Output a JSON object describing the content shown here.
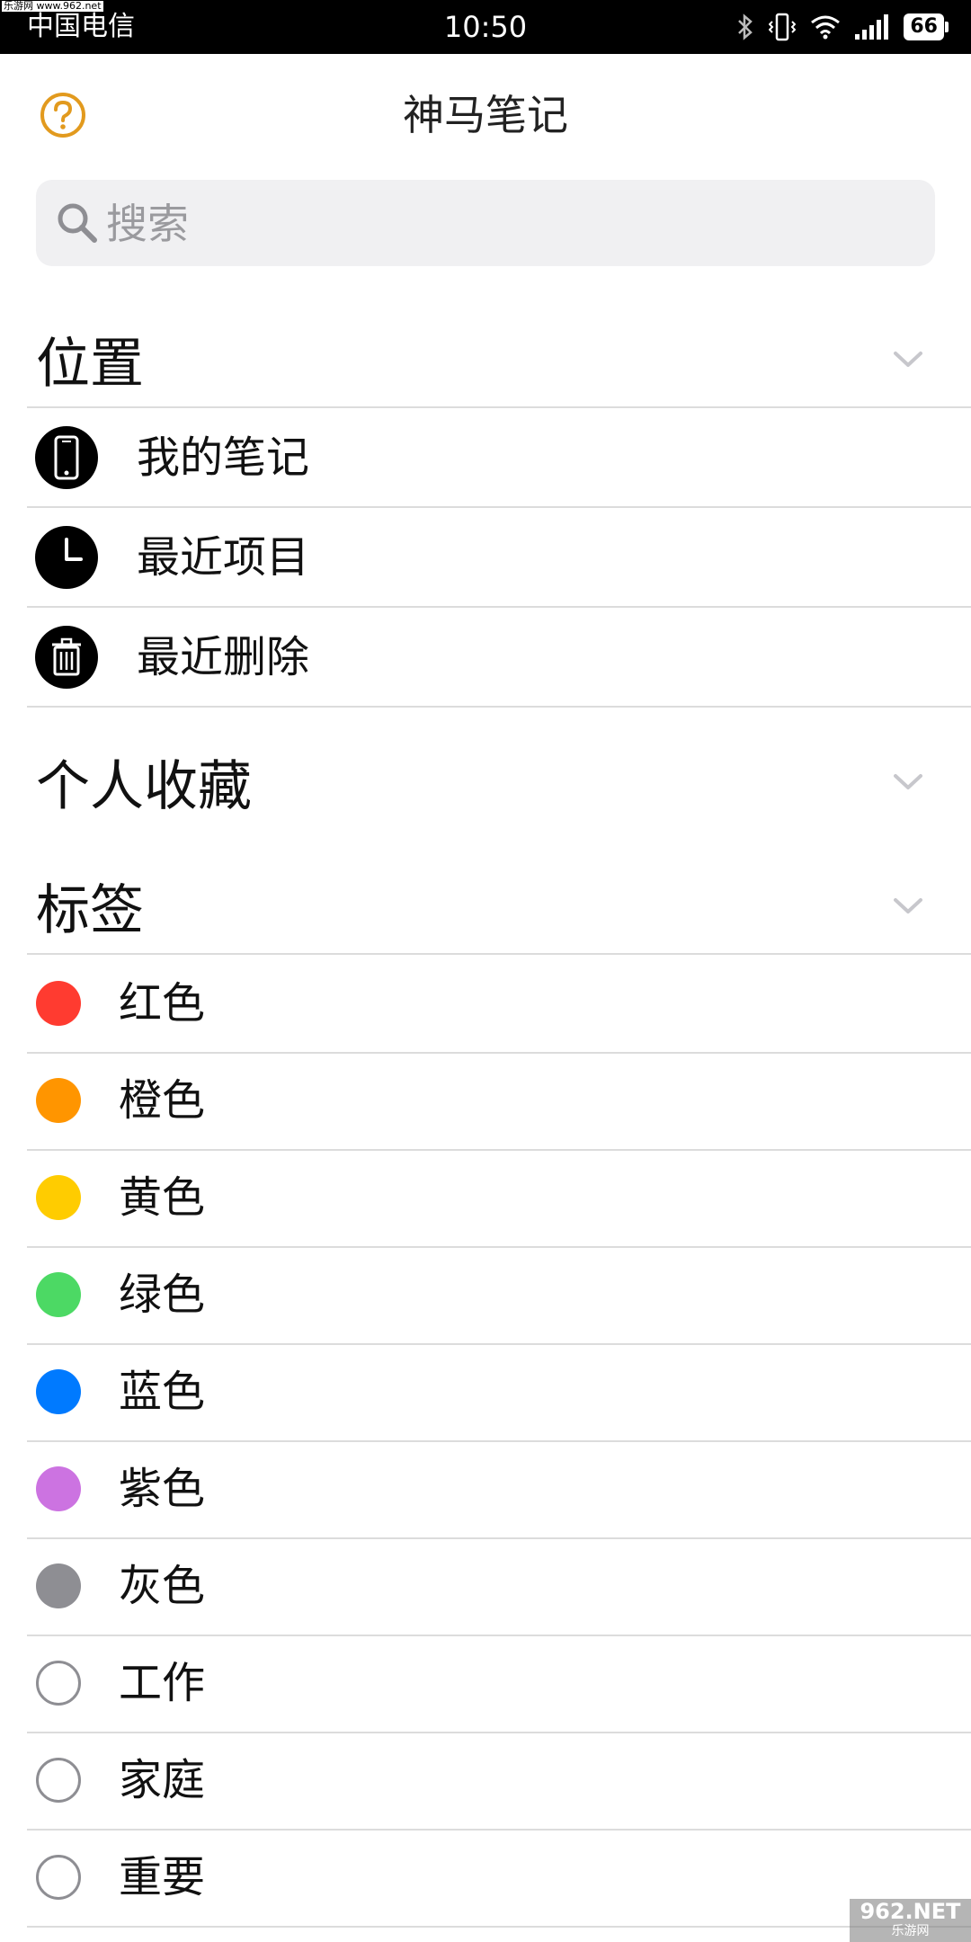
{
  "status_bar": {
    "watermark": "乐游网 www.962.net",
    "carrier": "中国电信",
    "time": "10:50",
    "battery": "66"
  },
  "header": {
    "title": "神马笔记",
    "help_icon": "question-circle-icon",
    "accent_color": "#e29a1e"
  },
  "search": {
    "placeholder": "搜索"
  },
  "sections": {
    "location": {
      "title": "位置",
      "items": [
        {
          "label": "我的笔记",
          "icon": "phone-icon"
        },
        {
          "label": "最近项目",
          "icon": "clock-icon"
        },
        {
          "label": "最近删除",
          "icon": "trash-icon"
        }
      ]
    },
    "favorites": {
      "title": "个人收藏"
    },
    "tags": {
      "title": "标签",
      "items": [
        {
          "label": "红色",
          "color": "#ff3b30"
        },
        {
          "label": "橙色",
          "color": "#ff9500"
        },
        {
          "label": "黄色",
          "color": "#ffcc00"
        },
        {
          "label": "绿色",
          "color": "#4cd964"
        },
        {
          "label": "蓝色",
          "color": "#007aff"
        },
        {
          "label": "紫色",
          "color": "#cc73e1"
        },
        {
          "label": "灰色",
          "color": "#8e8e93"
        },
        {
          "label": "工作",
          "color": "none"
        },
        {
          "label": "家庭",
          "color": "none"
        },
        {
          "label": "重要",
          "color": "none"
        }
      ]
    }
  },
  "corner_watermark": {
    "main": "962.NET",
    "sub": "乐游网"
  }
}
